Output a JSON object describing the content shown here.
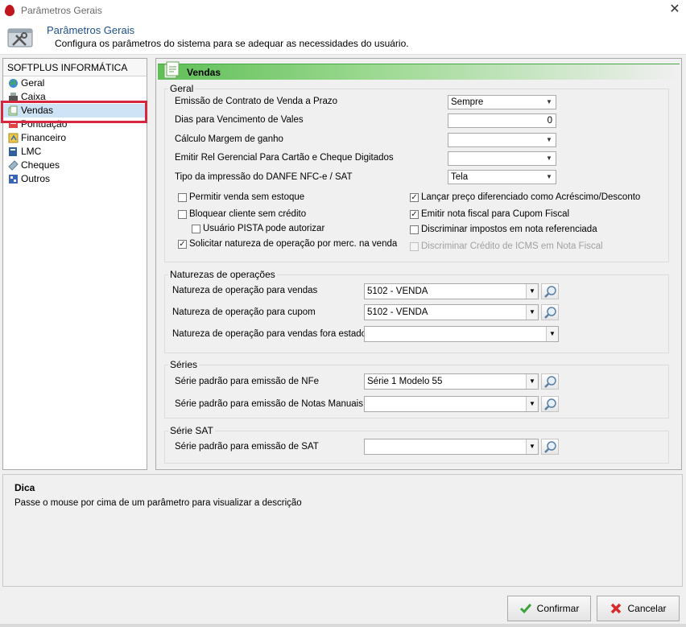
{
  "window": {
    "title": "Parâmetros Gerais",
    "close_glyph": "✕"
  },
  "header": {
    "title": "Parâmetros Gerais",
    "subtitle": "Configura os parâmetros do sistema para se adequar as necessidades do usuário."
  },
  "tree": {
    "root": "SOFTPLUS INFORMÁTICA",
    "items": [
      {
        "label": "Geral",
        "icon": "globe-icon"
      },
      {
        "label": "Caixa",
        "icon": "cash-register-icon"
      },
      {
        "label": "Vendas",
        "icon": "sales-icon",
        "selected": true
      },
      {
        "label": "Pontuação",
        "icon": "points-icon"
      },
      {
        "label": "Financeiro",
        "icon": "finance-icon"
      },
      {
        "label": "LMC",
        "icon": "book-icon"
      },
      {
        "label": "Cheques",
        "icon": "cheque-icon"
      },
      {
        "label": "Outros",
        "icon": "others-icon"
      }
    ]
  },
  "section": {
    "title": "Vendas"
  },
  "geral": {
    "legend": "Geral",
    "fields": {
      "contrato": {
        "label": "Emissão de Contrato de Venda a Prazo",
        "value": "Sempre"
      },
      "vales": {
        "label": "Dias para Vencimento de Vales",
        "value": "0"
      },
      "margem": {
        "label": "Cálculo Margem de ganho",
        "value": ""
      },
      "rel_gerencial": {
        "label": "Emitir Rel Gerencial Para Cartão e Cheque Digitados",
        "value": ""
      },
      "danfe": {
        "label": "Tipo da impressão do DANFE NFC-e / SAT",
        "value": "Tela"
      }
    },
    "checks": {
      "sem_estoque": {
        "label": "Permitir venda sem estoque",
        "checked": false
      },
      "bloquear": {
        "label": "Bloquear cliente sem crédito",
        "checked": false
      },
      "pista": {
        "label": "Usuário PISTA pode autorizar",
        "checked": false
      },
      "natureza_merc": {
        "label": "Solicitar natureza de operação por merc. na venda",
        "checked": true
      },
      "preco_dif": {
        "label": "Lançar preço diferenciado como Acréscimo/Desconto",
        "checked": true
      },
      "nota_cupom": {
        "label": "Emitir nota fiscal para Cupom Fiscal",
        "checked": true
      },
      "impostos": {
        "label": "Discriminar impostos em nota referenciada",
        "checked": false
      },
      "icms": {
        "label": "Discriminar Crédito de ICMS em Nota Fiscal",
        "checked": false,
        "disabled": true
      }
    }
  },
  "naturezas": {
    "legend": "Naturezas de operações",
    "vendas": {
      "label": "Natureza de operação para vendas",
      "value": "5102  - VENDA"
    },
    "cupom": {
      "label": "Natureza de operação para cupom",
      "value": "5102  - VENDA"
    },
    "fora_estado": {
      "label": "Natureza de operação para vendas fora estado",
      "value": ""
    }
  },
  "series": {
    "legend": "Séries",
    "nfe": {
      "label": "Série padrão para emissão de NFe",
      "value": "Série 1 Modelo 55"
    },
    "manuais": {
      "label": "Série padrão para emissão de Notas Manuais",
      "value": ""
    }
  },
  "serie_sat": {
    "legend": "Série SAT",
    "sat": {
      "label": "Série padrão para emissão de SAT",
      "value": ""
    }
  },
  "dica": {
    "title": "Dica",
    "text": "Passe o mouse por cima de um parâmetro para visualizar a descrição"
  },
  "buttons": {
    "confirm": "Confirmar",
    "cancel": "Cancelar"
  },
  "colors": {
    "accent_green": "#5fbf57",
    "selection_outline": "#d9263f",
    "header_title": "#1c4f8a"
  }
}
